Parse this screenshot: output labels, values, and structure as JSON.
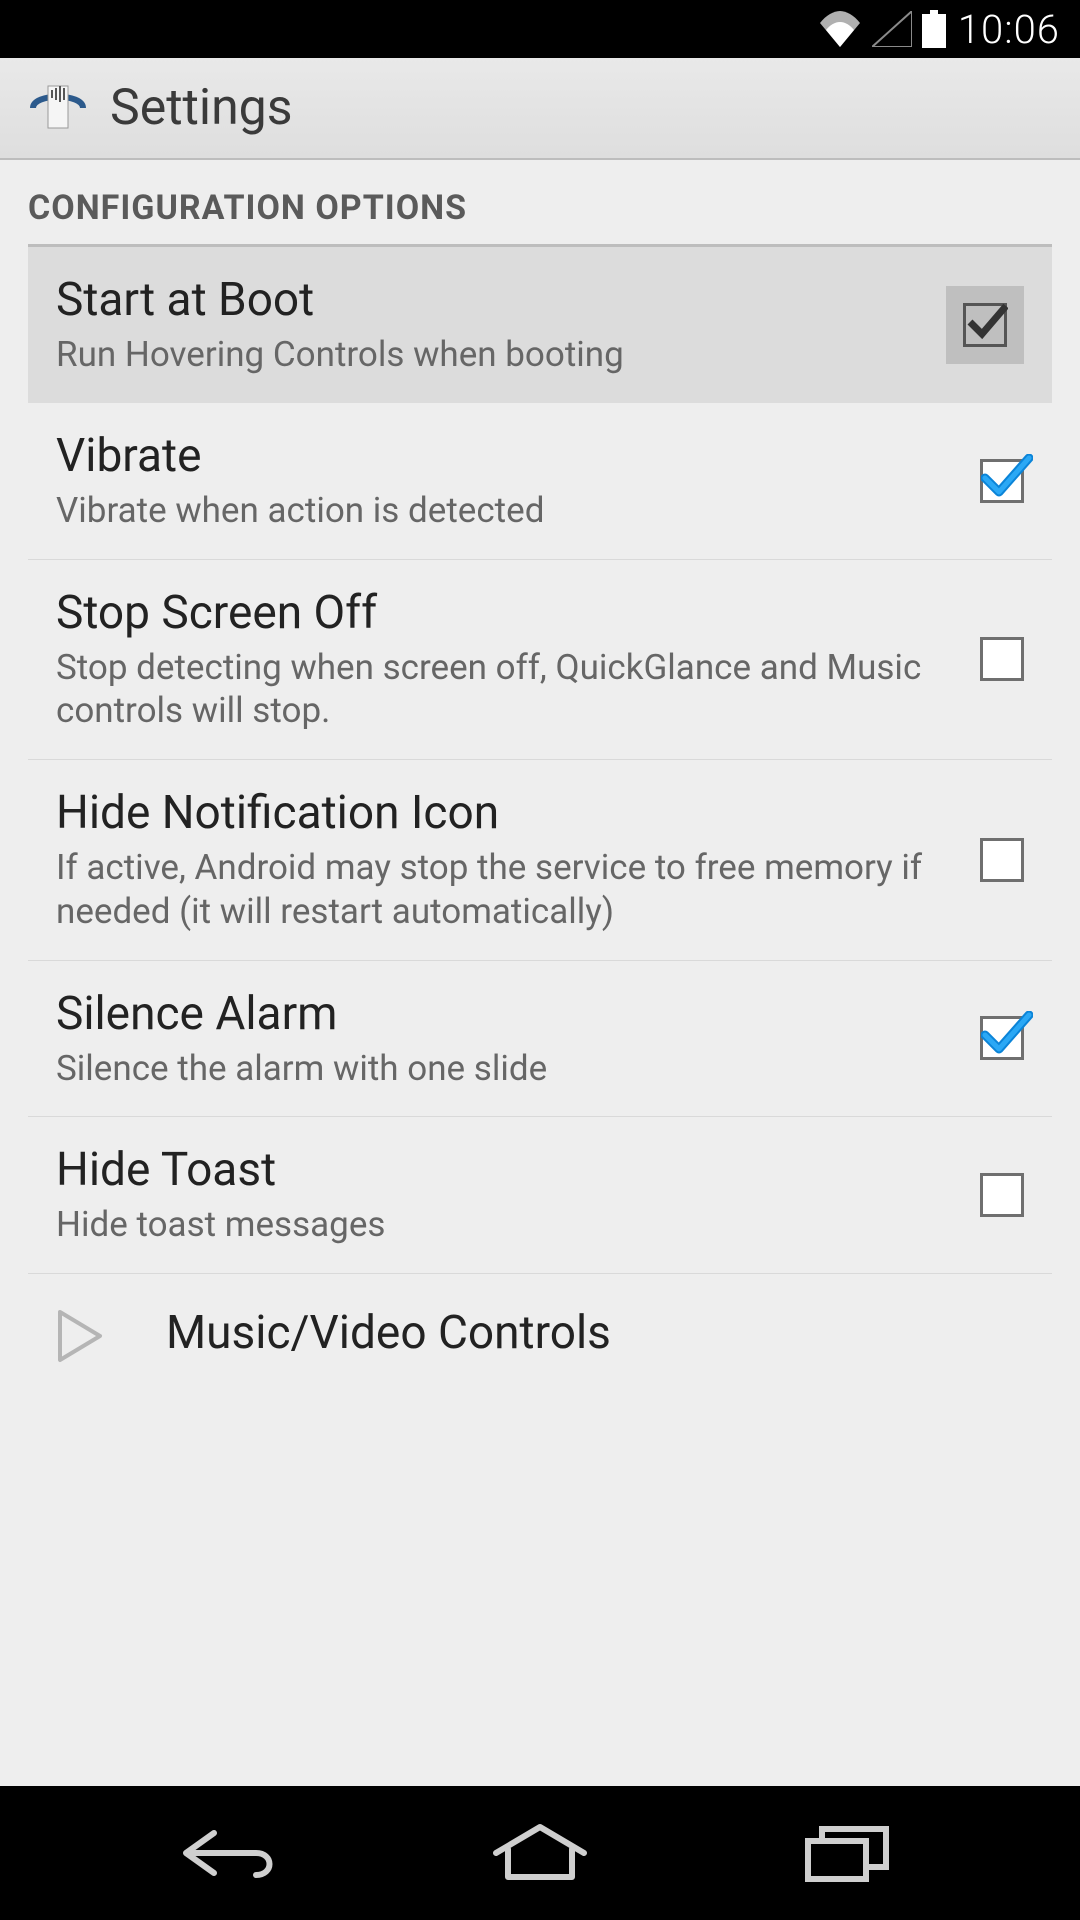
{
  "status_bar": {
    "time": "10:06"
  },
  "action_bar": {
    "title": "Settings"
  },
  "section": {
    "header": "CONFIGURATION OPTIONS"
  },
  "settings": [
    {
      "title": "Start at Boot",
      "summary": "Run Hovering Controls when booting",
      "checked": true,
      "pressed": true
    },
    {
      "title": "Vibrate",
      "summary": "Vibrate when action is detected",
      "checked": true,
      "pressed": false
    },
    {
      "title": "Stop Screen Off",
      "summary": "Stop detecting when screen off, QuickGlance and Music controls will stop.",
      "checked": false,
      "pressed": false
    },
    {
      "title": "Hide Notification Icon",
      "summary": "If active, Android may stop the service to free memory if needed (it will restart automatically)",
      "checked": false,
      "pressed": false
    },
    {
      "title": "Silence Alarm",
      "summary": "Silence the alarm with one slide",
      "checked": true,
      "pressed": false
    },
    {
      "title": "Hide Toast",
      "summary": "Hide toast messages",
      "checked": false,
      "pressed": false
    }
  ],
  "nav_link": {
    "label": "Music/Video Controls"
  }
}
